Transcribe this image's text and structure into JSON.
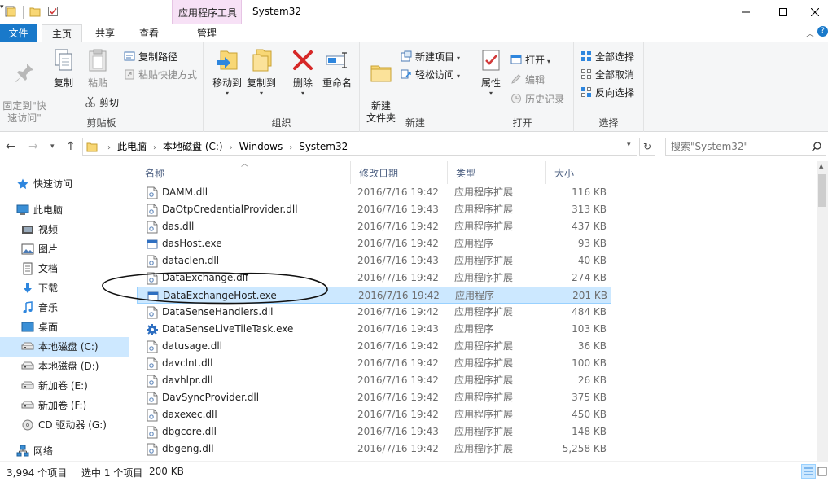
{
  "window": {
    "title": "System32",
    "contextual_group": "应用程序工具"
  },
  "tabs": {
    "file": "文件",
    "home": "主页",
    "share": "共享",
    "view": "查看",
    "manage": "管理"
  },
  "ribbon": {
    "clipboard": {
      "label": "剪贴板",
      "pin": "固定到\"快\n速访问\"",
      "copy": "复制",
      "paste": "粘贴",
      "copy_path": "复制路径",
      "paste_shortcut": "粘贴快捷方式",
      "cut": "剪切"
    },
    "organize": {
      "label": "组织",
      "move_to": "移动到",
      "copy_to": "复制到",
      "delete": "删除",
      "rename": "重命名"
    },
    "new": {
      "label": "新建",
      "new_folder": "新建\n文件夹",
      "new_item": "新建项目",
      "easy_access": "轻松访问"
    },
    "open": {
      "label": "打开",
      "properties": "属性",
      "open": "打开",
      "edit": "编辑",
      "history": "历史记录"
    },
    "select": {
      "label": "选择",
      "select_all": "全部选择",
      "select_none": "全部取消",
      "invert": "反向选择"
    }
  },
  "address": {
    "crumbs": [
      "此电脑",
      "本地磁盘 (C:)",
      "Windows",
      "System32"
    ],
    "search_placeholder": "搜索\"System32\""
  },
  "nav": {
    "items": [
      {
        "label": "快速访问",
        "icon": "star-icon",
        "level": 0
      },
      {
        "label": "此电脑",
        "icon": "computer-icon",
        "level": 0
      },
      {
        "label": "视频",
        "icon": "video-icon",
        "level": 1
      },
      {
        "label": "图片",
        "icon": "pictures-icon",
        "level": 1
      },
      {
        "label": "文档",
        "icon": "documents-icon",
        "level": 1
      },
      {
        "label": "下载",
        "icon": "download-icon",
        "level": 1
      },
      {
        "label": "音乐",
        "icon": "music-icon",
        "level": 1
      },
      {
        "label": "桌面",
        "icon": "desktop-icon",
        "level": 1
      },
      {
        "label": "本地磁盘 (C:)",
        "icon": "drive-icon",
        "level": 1,
        "selected": true
      },
      {
        "label": "本地磁盘 (D:)",
        "icon": "drive-icon",
        "level": 1
      },
      {
        "label": "新加卷 (E:)",
        "icon": "drive-icon",
        "level": 1
      },
      {
        "label": "新加卷 (F:)",
        "icon": "drive-icon",
        "level": 1
      },
      {
        "label": "CD 驱动器 (G:)",
        "icon": "cd-drive-icon",
        "level": 1
      },
      {
        "label": "网络",
        "icon": "network-icon",
        "level": 0
      }
    ]
  },
  "columns": {
    "name": "名称",
    "date": "修改日期",
    "type": "类型",
    "size": "大小"
  },
  "files": [
    {
      "name": "DAMM.dll",
      "date": "2016/7/16 19:42",
      "type": "应用程序扩展",
      "size": "116 KB",
      "icon": "dll-icon"
    },
    {
      "name": "DaOtpCredentialProvider.dll",
      "date": "2016/7/16 19:43",
      "type": "应用程序扩展",
      "size": "313 KB",
      "icon": "dll-icon"
    },
    {
      "name": "das.dll",
      "date": "2016/7/16 19:42",
      "type": "应用程序扩展",
      "size": "437 KB",
      "icon": "dll-icon"
    },
    {
      "name": "dasHost.exe",
      "date": "2016/7/16 19:42",
      "type": "应用程序",
      "size": "93 KB",
      "icon": "exe-icon"
    },
    {
      "name": "dataclen.dll",
      "date": "2016/7/16 19:43",
      "type": "应用程序扩展",
      "size": "40 KB",
      "icon": "dll-icon"
    },
    {
      "name": "DataExchange.dll",
      "date": "2016/7/16 19:42",
      "type": "应用程序扩展",
      "size": "274 KB",
      "icon": "dll-icon"
    },
    {
      "name": "DataExchangeHost.exe",
      "date": "2016/7/16 19:42",
      "type": "应用程序",
      "size": "201 KB",
      "icon": "exe-icon",
      "selected": true
    },
    {
      "name": "DataSenseHandlers.dll",
      "date": "2016/7/16 19:42",
      "type": "应用程序扩展",
      "size": "484 KB",
      "icon": "dll-icon"
    },
    {
      "name": "DataSenseLiveTileTask.exe",
      "date": "2016/7/16 19:43",
      "type": "应用程序",
      "size": "103 KB",
      "icon": "gear-exe-icon"
    },
    {
      "name": "datusage.dll",
      "date": "2016/7/16 19:42",
      "type": "应用程序扩展",
      "size": "36 KB",
      "icon": "dll-icon"
    },
    {
      "name": "davclnt.dll",
      "date": "2016/7/16 19:42",
      "type": "应用程序扩展",
      "size": "100 KB",
      "icon": "dll-icon"
    },
    {
      "name": "davhlpr.dll",
      "date": "2016/7/16 19:42",
      "type": "应用程序扩展",
      "size": "26 KB",
      "icon": "dll-icon"
    },
    {
      "name": "DavSyncProvider.dll",
      "date": "2016/7/16 19:42",
      "type": "应用程序扩展",
      "size": "375 KB",
      "icon": "dll-icon"
    },
    {
      "name": "daxexec.dll",
      "date": "2016/7/16 19:42",
      "type": "应用程序扩展",
      "size": "450 KB",
      "icon": "dll-icon"
    },
    {
      "name": "dbgcore.dll",
      "date": "2016/7/16 19:43",
      "type": "应用程序扩展",
      "size": "148 KB",
      "icon": "dll-icon"
    },
    {
      "name": "dbgeng.dll",
      "date": "2016/7/16 19:42",
      "type": "应用程序扩展",
      "size": "5,258 KB",
      "icon": "dll-icon"
    }
  ],
  "status": {
    "count": "3,994 个项目",
    "selected": "选中 1 个项目",
    "size": "200 KB"
  },
  "colors": {
    "accent": "#1979ca",
    "selection": "#cce8ff",
    "contextual": "#f7e1f6"
  }
}
